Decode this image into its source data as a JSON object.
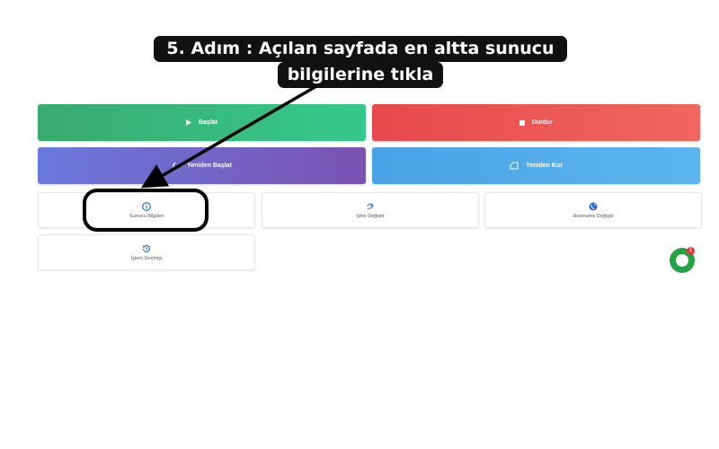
{
  "annotation": {
    "line1": "5. Adım : Açılan sayfada en altta sunucu",
    "line2": "bilgilerine tıkla"
  },
  "actions": {
    "start_label": "Başlat",
    "stop_label": "Durdur",
    "restart_label": "Yeniden Başlat",
    "reinstall_label": "Yeniden Kur"
  },
  "cards": {
    "server_info": "Sunucu Bilgileri",
    "change_password": "Şifre Değiştir",
    "change_hostname": "Hostname Değiştir",
    "history": "İşlem Geçmişi"
  },
  "chat": {
    "badge": "1"
  },
  "colors": {
    "start": "#35c98c",
    "stop": "#e7484c",
    "restart": "#7a52b3",
    "reinstall": "#4aa2e6",
    "icon_blue": "#2a6fd6",
    "chat": "#25a244"
  }
}
